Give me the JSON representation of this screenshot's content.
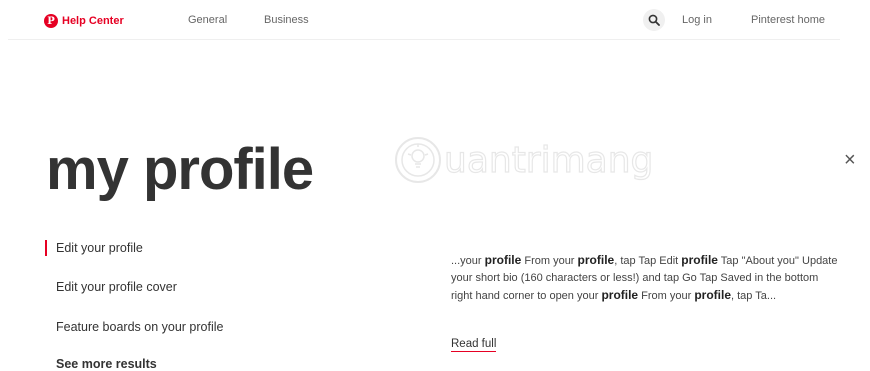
{
  "header": {
    "logo_mark": "P",
    "logo_text": "Help Center",
    "nav": {
      "general": "General",
      "business": "Business"
    },
    "login": "Log in",
    "home": "Pinterest home",
    "search_icon": "search-icon"
  },
  "main": {
    "title": "my profile",
    "close_glyph": "×",
    "results": [
      {
        "label": "Edit your profile"
      },
      {
        "label": "Edit your profile cover"
      },
      {
        "label": "Feature boards on your profile"
      }
    ],
    "see_more": "See more results",
    "snippet": [
      {
        "t": "...your "
      },
      {
        "b": "profile"
      },
      {
        "t": " From your "
      },
      {
        "b": "profile"
      },
      {
        "t": ", tap   Tap Edit "
      },
      {
        "b": "profile"
      },
      {
        "t": " Tap \"About you\" Update your short bio (160 characters or less!) and tap Go Tap Saved in the bottom right hand corner to open your "
      },
      {
        "b": "profile"
      },
      {
        "t": " From your "
      },
      {
        "b": "profile"
      },
      {
        "t": ", tap   Ta..."
      }
    ],
    "read_full": "Read full"
  },
  "watermark": "uantrimang",
  "colors": {
    "accent": "#e60023",
    "title": "#333333"
  }
}
